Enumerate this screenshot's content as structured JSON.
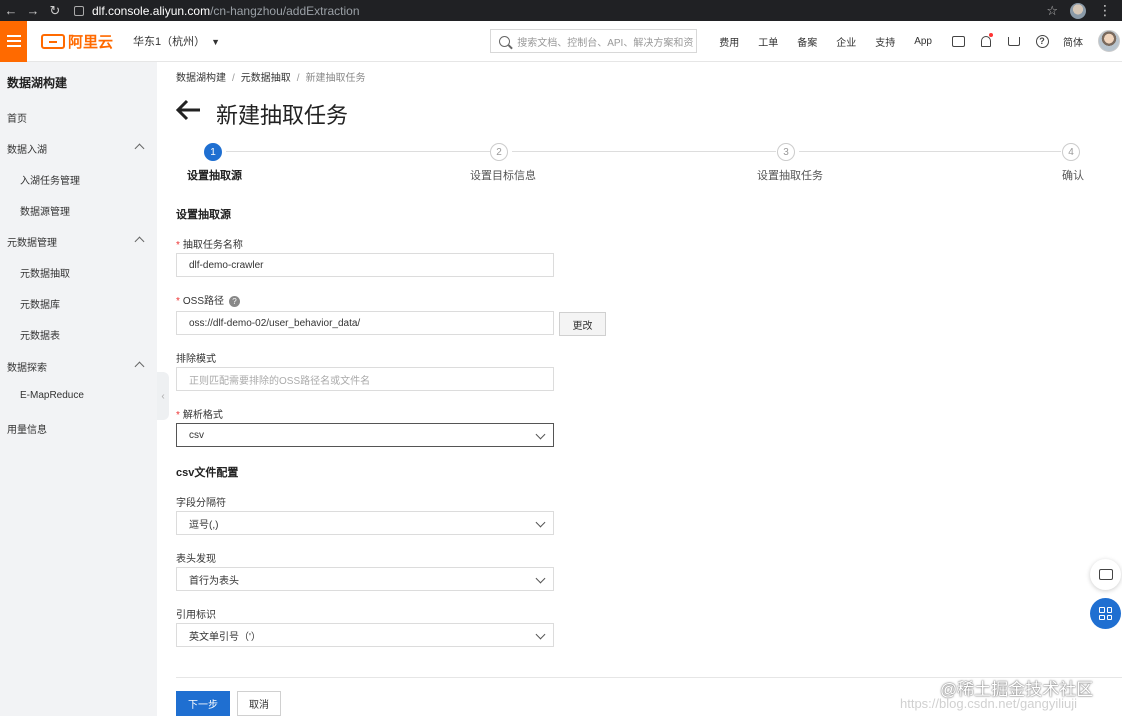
{
  "browser": {
    "url_host": "dlf.console.aliyun.com",
    "url_path": "/cn-hangzhou/addExtraction"
  },
  "header": {
    "logo_text": "阿里云",
    "region": "华东1（杭州）",
    "search_placeholder": "搜索文档、控制台、API、解决方案和资",
    "links": [
      "费用",
      "工单",
      "备案",
      "企业",
      "支持",
      "App"
    ],
    "language": "简体"
  },
  "sidebar": {
    "title": "数据湖构建",
    "items": [
      {
        "label": "首页"
      },
      {
        "label": "数据入湖"
      },
      {
        "label": "入湖任务管理"
      },
      {
        "label": "数据源管理"
      },
      {
        "label": "元数据管理"
      },
      {
        "label": "元数据抽取"
      },
      {
        "label": "元数据库"
      },
      {
        "label": "元数据表"
      },
      {
        "label": "数据探索"
      },
      {
        "label": "E-MapReduce"
      },
      {
        "label": "用量信息"
      }
    ]
  },
  "breadcrumb": [
    "数据湖构建",
    "元数据抽取",
    "新建抽取任务"
  ],
  "page_title": "新建抽取任务",
  "steps": [
    {
      "num": "1",
      "label": "设置抽取源"
    },
    {
      "num": "2",
      "label": "设置目标信息"
    },
    {
      "num": "3",
      "label": "设置抽取任务"
    },
    {
      "num": "4",
      "label": "确认"
    }
  ],
  "form": {
    "section_source": "设置抽取源",
    "task_name_label": "抽取任务名称",
    "task_name_value": "dlf-demo-crawler",
    "oss_label": "OSS路径",
    "oss_value": "oss://dlf-demo-02/user_behavior_data/",
    "change_btn": "更改",
    "exclude_label": "排除模式",
    "exclude_placeholder": "正则匹配需要排除的OSS路径名或文件名",
    "format_label": "解析格式",
    "format_value": "csv",
    "section_csv": "csv文件配置",
    "delimiter_label": "字段分隔符",
    "delimiter_value": "逗号(,)",
    "header_label": "表头发现",
    "header_value": "首行为表头",
    "quote_label": "引用标识",
    "quote_value": "英文单引号（'）"
  },
  "actions": {
    "next": "下一步",
    "cancel": "取消"
  },
  "watermark": "@稀土掘金技术社区",
  "watermark_faint": "https://blog.csdn.net/gangyiliuji",
  "colors": {
    "accent": "#ff6a00",
    "primary": "#1f6fd1"
  }
}
